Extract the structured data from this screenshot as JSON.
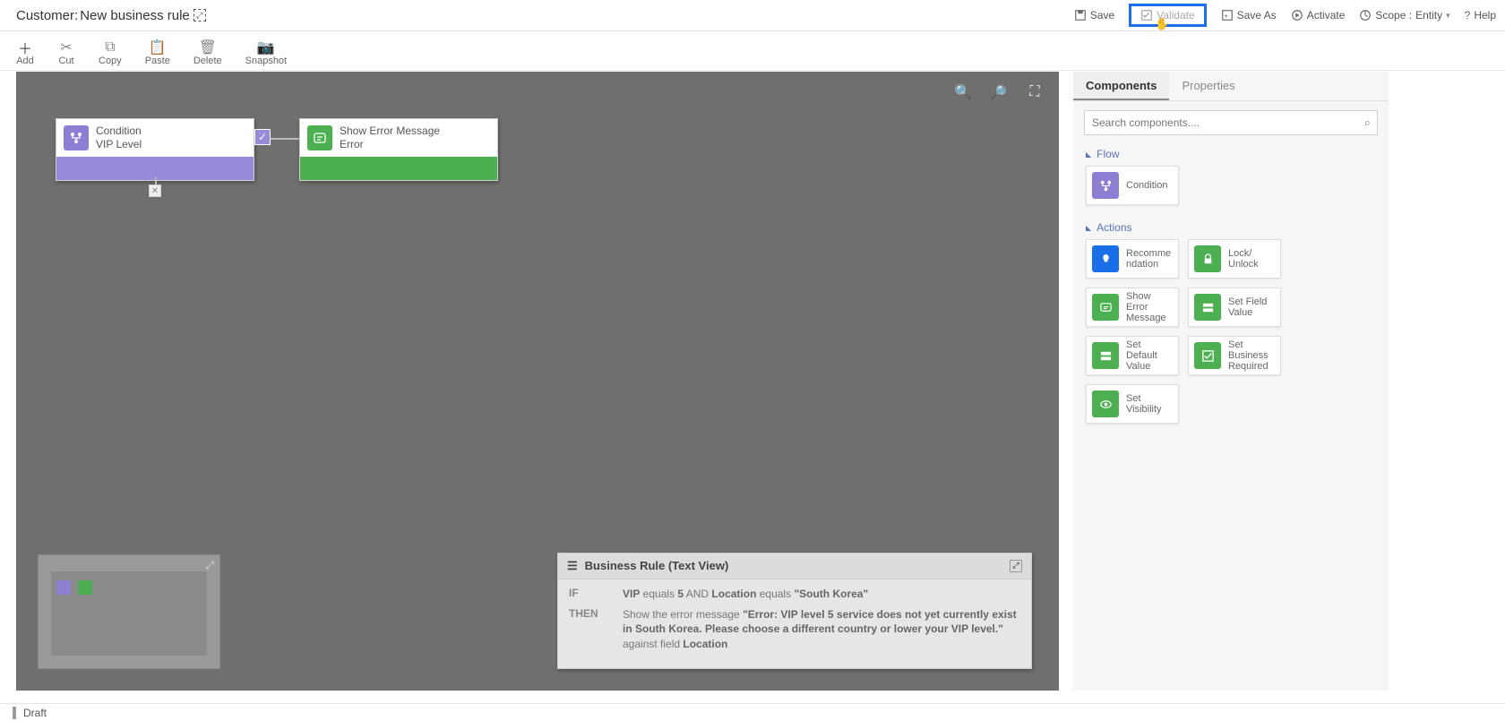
{
  "header": {
    "title_prefix": "Customer:",
    "title_name": "New business rule",
    "actions": {
      "save": "Save",
      "validate": "Validate",
      "saveas": "Save As",
      "activate": "Activate",
      "scope_label": "Scope :",
      "scope_value": "Entity",
      "help": "Help"
    }
  },
  "toolbar": {
    "add": "Add",
    "cut": "Cut",
    "copy": "Copy",
    "paste": "Paste",
    "delete": "Delete",
    "snapshot": "Snapshot"
  },
  "canvas": {
    "condition": {
      "title": "Condition",
      "subtitle": "VIP Level"
    },
    "error": {
      "title": "Show Error Message",
      "subtitle": "Error"
    }
  },
  "textview": {
    "title": "Business Rule (Text View)",
    "if_kw": "IF",
    "then_kw": "THEN",
    "if_vip": "VIP",
    "if_eq1": " equals ",
    "if_five": "5",
    "if_and": " AND ",
    "if_loc": "Location",
    "if_eq2": " equals ",
    "if_val": "\"South Korea\"",
    "then_pre": "Show the error message ",
    "then_msg": "\"Error: VIP level 5 service does not yet currently exist in South Korea. Please choose a different country or lower your VIP level.\"",
    "then_against": " against field ",
    "then_field": "Location"
  },
  "side": {
    "tab_components": "Components",
    "tab_properties": "Properties",
    "search_placeholder": "Search components....",
    "section_flow": "Flow",
    "section_actions": "Actions",
    "comp_condition": "Condition",
    "comp_recommendation": "Recomme\nndation",
    "comp_lock": "Lock/\nUnlock",
    "comp_showerr": "Show Error\nMessage",
    "comp_setfield": "Set Field\nValue",
    "comp_setdefault": "Set Default\nValue",
    "comp_bizreq": "Set\nBusiness\nRequired",
    "comp_setvis": "Set\nVisibility"
  },
  "status": {
    "text": "Draft"
  }
}
